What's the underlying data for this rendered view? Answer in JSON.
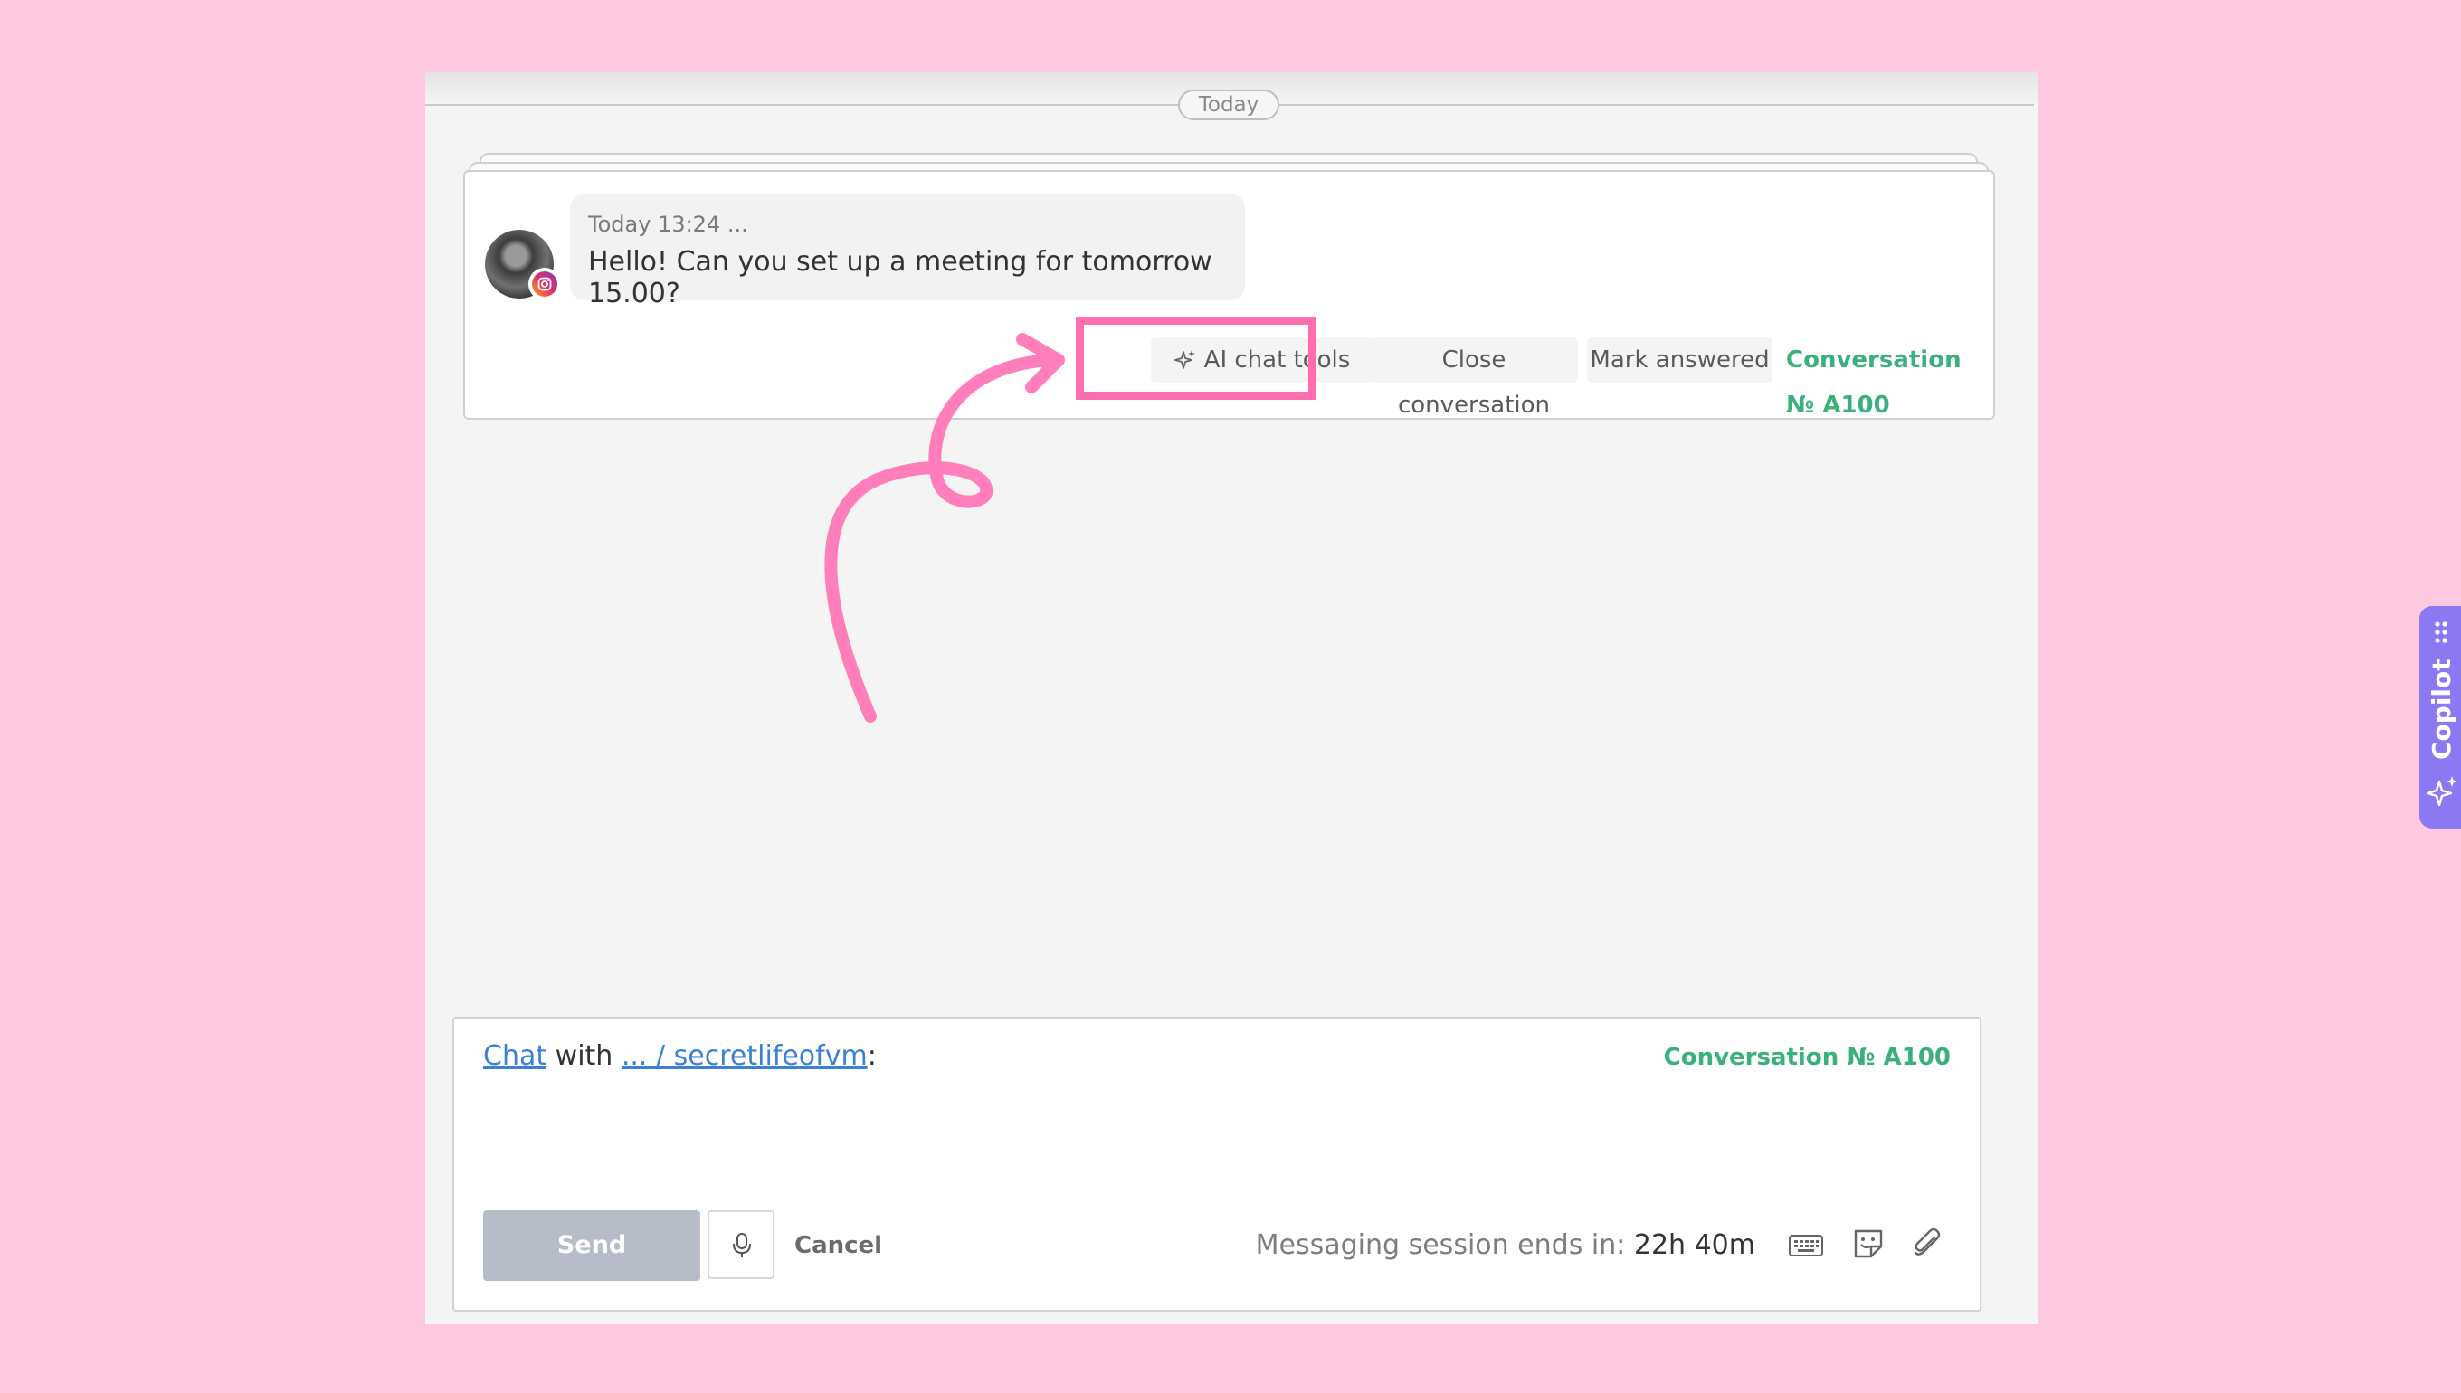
{
  "date_divider": "Today",
  "message": {
    "time": "Today 13:24 ...",
    "text": "Hello! Can you set up a meeting for tomorrow 15.00?"
  },
  "actions": {
    "ai_tools": "AI chat tools",
    "close": "Close conversation",
    "mark": "Mark answered",
    "conversation": "Conversation № A100"
  },
  "copilot": {
    "label": "Copilot"
  },
  "composer": {
    "chat_link": "Chat",
    "with": "with",
    "contact_link": "... / secretlifeofvm",
    "colon": ":",
    "conversation": "Conversation № A100",
    "send": "Send",
    "cancel": "Cancel",
    "session_label": "Messaging session ends in:",
    "session_value": "22h 40m"
  },
  "colors": {
    "background": "#ffc8e1",
    "accent_green": "#3ab07a",
    "highlight_pink": "#ff6db1",
    "copilot_purple": "#8a79f2",
    "link_blue": "#3b82d6"
  }
}
